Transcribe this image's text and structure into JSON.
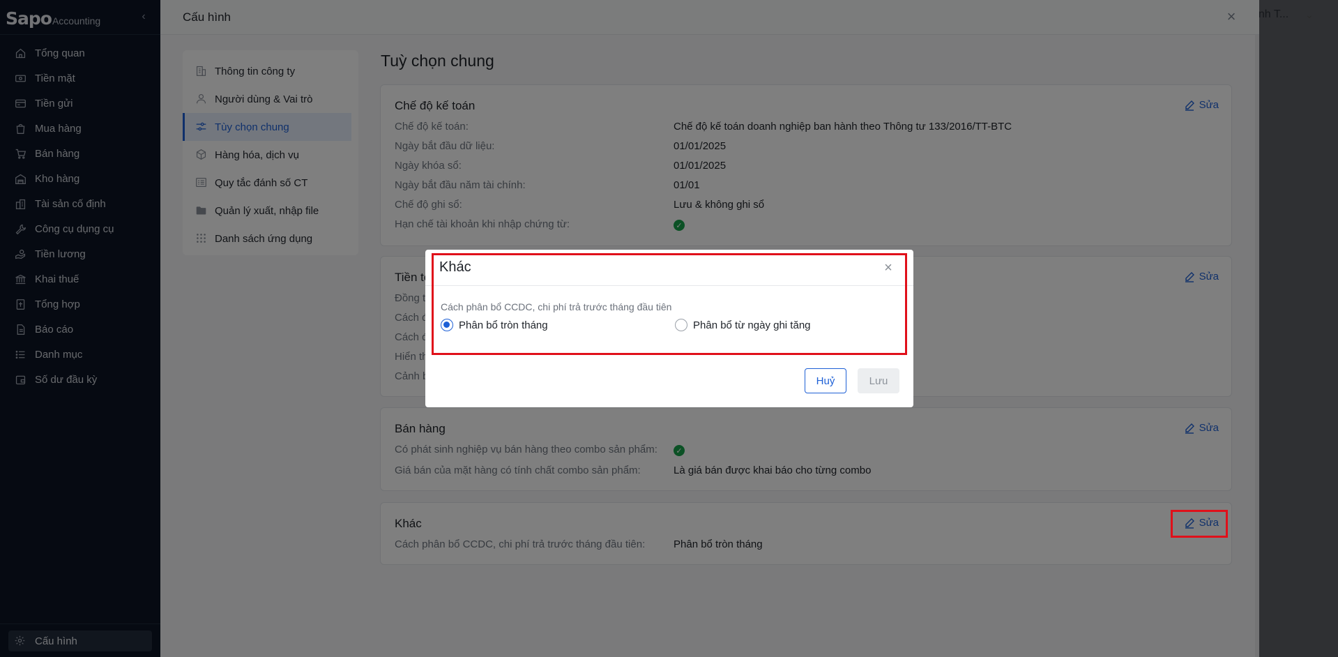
{
  "app": {
    "logo_brand": "Sapo",
    "logo_sub": "Accounting",
    "nav": [
      {
        "label": "Tổng quan",
        "icon": "home-icon"
      },
      {
        "label": "Tiền mặt",
        "icon": "cash-icon"
      },
      {
        "label": "Tiền gửi",
        "icon": "card-icon"
      },
      {
        "label": "Mua hàng",
        "icon": "bag-icon"
      },
      {
        "label": "Bán hàng",
        "icon": "cart-icon"
      },
      {
        "label": "Kho hàng",
        "icon": "warehouse-icon"
      },
      {
        "label": "Tài sản cố định",
        "icon": "building-icon"
      },
      {
        "label": "Công cụ dụng cụ",
        "icon": "tool-icon"
      },
      {
        "label": "Tiền lương",
        "icon": "salary-icon"
      },
      {
        "label": "Khai thuế",
        "icon": "bank-icon"
      },
      {
        "label": "Tổng hợp",
        "icon": "ledger-icon"
      },
      {
        "label": "Báo cáo",
        "icon": "report-icon"
      },
      {
        "label": "Danh mục",
        "icon": "list-icon"
      },
      {
        "label": "Số dư đầu kỳ",
        "icon": "wallet-icon"
      }
    ],
    "config_label": "Cấu hình",
    "user_name": "anh T..."
  },
  "panel": {
    "title": "Cấu hình",
    "settings_nav": [
      {
        "label": "Thông tin công ty",
        "icon": "company-icon"
      },
      {
        "label": "Người dùng & Vai trò",
        "icon": "user-icon"
      },
      {
        "label": "Tùy chọn chung",
        "icon": "sliders-icon"
      },
      {
        "label": "Hàng hóa, dịch vụ",
        "icon": "box-icon"
      },
      {
        "label": "Quy tắc đánh số CT",
        "icon": "numbering-icon"
      },
      {
        "label": "Quản lý xuất, nhập file",
        "icon": "folder-icon"
      },
      {
        "label": "Danh sách ứng dụng",
        "icon": "apps-icon"
      }
    ],
    "content_title": "Tuỳ chọn chung",
    "edit_label": "Sửa",
    "cards": {
      "accounting": {
        "title": "Chế độ kế toán",
        "rows": [
          {
            "label": "Chế độ kế toán:",
            "value": "Chế độ kế toán doanh nghiệp ban hành theo Thông tư 133/2016/TT-BTC"
          },
          {
            "label": "Ngày bắt đầu dữ liệu:",
            "value": "01/01/2025"
          },
          {
            "label": "Ngày khóa sổ:",
            "value": "01/01/2025"
          },
          {
            "label": "Ngày bắt đầu năm tài chính:",
            "value": "01/01"
          },
          {
            "label": "Chế độ ghi sổ:",
            "value": "Lưu & không ghi sổ"
          },
          {
            "label": "Hạn chế tài khoản khi nhập chứng từ:",
            "value": ""
          }
        ]
      },
      "currency": {
        "title": "Tiền tệ",
        "rows": [
          {
            "label": "Đồng ti"
          },
          {
            "label": "Cách đ"
          },
          {
            "label": "Cách đ"
          },
          {
            "label": "Hiển th"
          },
          {
            "label": "Cảnh b"
          }
        ]
      },
      "sales": {
        "title": "Bán hàng",
        "rows": [
          {
            "label": "Có phát sinh nghiệp vụ bán hàng theo combo sản phẩm:",
            "value": ""
          },
          {
            "label": "Giá bán của mặt hàng có tính chất combo sản phẩm:",
            "value": "Là giá bán được khai báo cho từng combo"
          }
        ]
      },
      "other": {
        "title": "Khác",
        "rows": [
          {
            "label": "Cách phân bổ CCDC, chi phí trả trước tháng đầu tiên:",
            "value": "Phân bổ tròn tháng"
          }
        ]
      }
    }
  },
  "modal": {
    "title": "Khác",
    "field_label": "Cách phân bổ CCDC, chi phí trả trước tháng đầu tiên",
    "option_1": "Phân bổ tròn tháng",
    "option_2": "Phân bổ từ ngày ghi tăng",
    "selected": "option_1",
    "cancel_label": "Huỷ",
    "save_label": "Lưu"
  },
  "colors": {
    "accent": "#1e60d6",
    "sidebar_bg": "#0c1424",
    "highlight": "#e0101a",
    "success": "#16a34a"
  }
}
